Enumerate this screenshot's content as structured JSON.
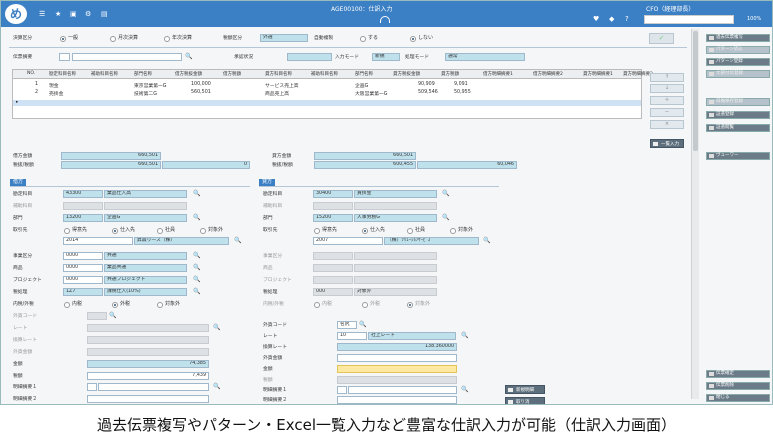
{
  "app": {
    "logo": "め",
    "title": "AGE00100：仕訳入力",
    "user": "CFO（経理部長）",
    "zoom": "100",
    "zoom_unit": "%"
  },
  "header": {
    "closing_label": "決算区分",
    "closing_options": [
      "一般",
      "月次決算",
      "年次決算"
    ],
    "tax_label": "税額区分",
    "tax_value": "外選",
    "auto_copy_label": "自動複製",
    "auto_copy_options": [
      "する",
      "しない"
    ],
    "ledger_label": "伝票摘要",
    "approval_label": "承認状況",
    "input_mode_label": "入力モード",
    "input_mode_value": "新規",
    "process_mode_label": "処理モード",
    "process_mode_value": "通常"
  },
  "grid": {
    "headers": [
      "NO.",
      "勘定科目名称",
      "補助科目名称",
      "部門名称",
      "借方税抜金額",
      "借方税額",
      "貸方科目名称",
      "補助科目名称",
      "部門名称",
      "貸方税抜金額",
      "貸方税額",
      "借方明細摘要1",
      "借方明細摘要2",
      "貸方明細摘要1",
      "貸方明細摘要2"
    ],
    "rows": [
      {
        "no": "1",
        "debit_account": "現金",
        "debit_dept": "東京営業第一G",
        "debit_amount": "100,000",
        "credit_account": "サービス売上高",
        "credit_dept": "企画G",
        "credit_amount": "90,909",
        "credit_tax": "9,091"
      },
      {
        "no": "2",
        "debit_account": "売掛金",
        "debit_dept": "技術第二G",
        "debit_amount": "560,501",
        "credit_account": "商品売上高",
        "credit_dept": "大阪営業第一G",
        "credit_amount": "509,546",
        "credit_tax": "50,955"
      }
    ],
    "bulk_input": "一覧入力"
  },
  "totals": {
    "debit_total_label": "借方金額",
    "debit_total": "660,501",
    "debit_ex_label": "税抜/税額",
    "debit_ex": "660,501",
    "debit_tax": "0",
    "credit_total_label": "貸方金額",
    "credit_total": "660,501",
    "credit_ex_label": "税抜/税額",
    "credit_ex": "600,455",
    "credit_tax": "60,046"
  },
  "debit": {
    "title": "借方",
    "account_label": "勘定科目",
    "account_code": "43300",
    "account_name": "業品仕入高",
    "sub_label": "補助科目",
    "dept_label": "部門",
    "dept_code": "13200",
    "dept_name": "企画G",
    "partner_label": "取引先",
    "partner_options": [
      "得意先",
      "仕入先",
      "社員",
      "対象外"
    ],
    "partner_code": "2014",
    "partner_name": "昇森リース（株）",
    "business_label": "事業区分",
    "business_code": "0000",
    "business_name": "共通",
    "brand_label": "商品",
    "brand_code": "0000",
    "brand_name": "業品共通",
    "project_label": "プロジェクト",
    "project_code": "0000",
    "project_name": "共通プロジェクト",
    "taxrule_label": "税処理",
    "taxrule_code": "1Z7",
    "taxrule_name": "課税仕入(10%)",
    "inout_label": "内税/外税",
    "inout_options": [
      "内税",
      "外税",
      "対象外"
    ],
    "fx_label": "外貨コード",
    "rate_label": "レート",
    "conv_label": "換算レート",
    "fxamt_label": "外貨金額",
    "amount_label": "金額",
    "amount": "74,385",
    "tax_label": "税額",
    "tax": "7,439",
    "memo1_label": "明細摘要１",
    "memo2_label": "明細摘要２"
  },
  "credit": {
    "title": "貸方",
    "account_label": "勘定科目",
    "account_code": "30400",
    "account_name": "買掛金",
    "sub_label": "補助科目",
    "dept_label": "部門",
    "dept_code": "15200",
    "dept_name": "人事労務G",
    "partner_label": "取引先",
    "partner_options": [
      "得意先",
      "仕入先",
      "社員",
      "対象外"
    ],
    "partner_code": "2007",
    "partner_name": "（株）ｿﾘｭｰｼｮﾝｻｰﾋﾞｽ",
    "business_label": "事業区分",
    "brand_label": "商品",
    "project_label": "プロジェクト",
    "taxrule_label": "税処理",
    "taxrule_code": "000",
    "taxrule_name": "対象外",
    "inout_label": "内税/外税",
    "inout_options": [
      "内税",
      "外税",
      "対象外"
    ],
    "fx_label": "外貨コード",
    "fx_code": "名尻",
    "rate_label": "レート",
    "rate_code": "10",
    "rate_name": "社上レート",
    "conv_label": "換算レート",
    "conv_value": "138.360000",
    "fxamt_label": "外貨金額",
    "amount_label": "金額",
    "tax_label": "税額",
    "memo1_label": "明細摘要１",
    "memo2_label": "明細摘要２"
  },
  "side": {
    "items": [
      "過去伝票複写",
      "パターン読込",
      "パターン登録",
      "文部付伝登録",
      "日報保存登録",
      "証憑登録",
      "証憑閲覧",
      "ヴューワー"
    ],
    "bottom": [
      "伝票確定",
      "伝票削除",
      "閉じる"
    ]
  },
  "mid_buttons": {
    "new_detail": "新規明細",
    "cancel": "取り消"
  },
  "caption": "過去伝票複写やパターン・Excel一覧入力など豊富な仕訳入力が可能（仕訳入力画面）",
  "colors": {
    "brand": "#3b7fc4",
    "teal": "#bfe1ec",
    "highlight": "#ffe9a0"
  }
}
